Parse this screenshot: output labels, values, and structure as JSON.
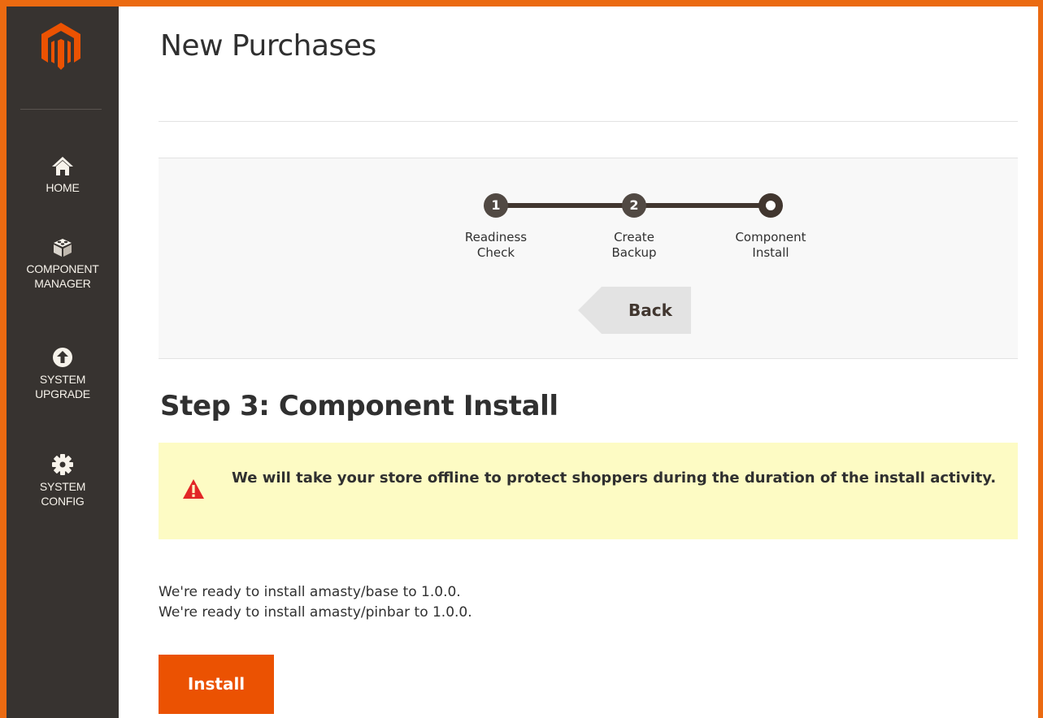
{
  "sidebar": {
    "logo_icon": "magento-logo-icon",
    "items": [
      {
        "label_line1": "HOME",
        "label_line2": "",
        "icon": "home-icon"
      },
      {
        "label_line1": "COMPONENT",
        "label_line2": "MANAGER",
        "icon": "cube-icon"
      },
      {
        "label_line1": "SYSTEM",
        "label_line2": "UPGRADE",
        "icon": "upload-icon"
      },
      {
        "label_line1": "SYSTEM",
        "label_line2": "CONFIG",
        "icon": "gear-icon"
      }
    ]
  },
  "page": {
    "title": "New Purchases"
  },
  "progress": {
    "steps": [
      {
        "number": "1",
        "label_line1": "Readiness",
        "label_line2": "Check",
        "status": "done"
      },
      {
        "number": "2",
        "label_line1": "Create",
        "label_line2": "Backup",
        "status": "done"
      },
      {
        "number": "",
        "label_line1": "Component",
        "label_line2": "Install",
        "status": "current"
      }
    ],
    "back_label": "Back"
  },
  "step": {
    "heading": "Step 3: Component Install",
    "warning_icon": "warning-triangle-icon",
    "warning_text": "We will take your store offline to protect shoppers during the duration of the install activity.",
    "ready_lines": [
      "We're ready to install amasty/base to 1.0.0.",
      "We're ready to install amasty/pinbar to 1.0.0."
    ],
    "install_label": "Install"
  },
  "colors": {
    "frame_border": "#eb6a11",
    "sidebar_bg": "#373330",
    "accent_button": "#eb5202",
    "warning_bg": "#fdfbc4",
    "warning_icon": "#e22626",
    "progress_dark": "#41362f"
  }
}
